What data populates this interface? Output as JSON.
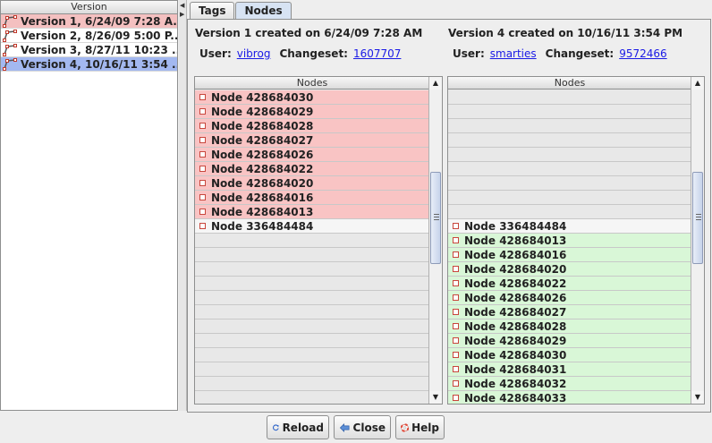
{
  "versions_panel": {
    "header": "Version",
    "items": [
      {
        "label": "Version 1, 6/24/09 7:28 A...",
        "style": "red"
      },
      {
        "label": "Version 2, 8/26/09 5:00 P...",
        "style": "white"
      },
      {
        "label": "Version 3, 8/27/11 10:23 ...",
        "style": "white"
      },
      {
        "label": "Version 4, 10/16/11 3:54 ...",
        "style": "blue"
      }
    ]
  },
  "tabs": [
    {
      "label": "Tags",
      "active": false
    },
    {
      "label": "Nodes",
      "active": true
    }
  ],
  "left_version": {
    "title": "Version 1 created on 6/24/09 7:28 AM",
    "user_label": "User:",
    "user": "vibrog",
    "changeset_label": "Changeset:",
    "changeset": "1607707"
  },
  "right_version": {
    "title": "Version 4 created on 10/16/11 3:54 PM",
    "user_label": "User:",
    "user": "smarties",
    "changeset_label": "Changeset:",
    "changeset": "9572466"
  },
  "left_table": {
    "header": "Nodes",
    "rows": [
      {
        "label": "Node 428684030",
        "style": "red"
      },
      {
        "label": "Node 428684029",
        "style": "red"
      },
      {
        "label": "Node 428684028",
        "style": "red"
      },
      {
        "label": "Node 428684027",
        "style": "red"
      },
      {
        "label": "Node 428684026",
        "style": "red"
      },
      {
        "label": "Node 428684022",
        "style": "red"
      },
      {
        "label": "Node 428684020",
        "style": "red"
      },
      {
        "label": "Node 428684016",
        "style": "red"
      },
      {
        "label": "Node 428684013",
        "style": "red"
      },
      {
        "label": "Node 336484484",
        "style": "plain"
      },
      {
        "label": "",
        "style": "empty"
      },
      {
        "label": "",
        "style": "empty"
      },
      {
        "label": "",
        "style": "empty"
      },
      {
        "label": "",
        "style": "empty"
      },
      {
        "label": "",
        "style": "empty"
      },
      {
        "label": "",
        "style": "empty"
      },
      {
        "label": "",
        "style": "empty"
      },
      {
        "label": "",
        "style": "empty"
      },
      {
        "label": "",
        "style": "empty"
      },
      {
        "label": "",
        "style": "empty"
      },
      {
        "label": "",
        "style": "empty"
      },
      {
        "label": "",
        "style": "empty"
      }
    ]
  },
  "right_table": {
    "header": "Nodes",
    "rows": [
      {
        "label": "",
        "style": "empty"
      },
      {
        "label": "",
        "style": "empty"
      },
      {
        "label": "",
        "style": "empty"
      },
      {
        "label": "",
        "style": "empty"
      },
      {
        "label": "",
        "style": "empty"
      },
      {
        "label": "",
        "style": "empty"
      },
      {
        "label": "",
        "style": "empty"
      },
      {
        "label": "",
        "style": "empty"
      },
      {
        "label": "",
        "style": "empty"
      },
      {
        "label": "Node 336484484",
        "style": "plain"
      },
      {
        "label": "Node 428684013",
        "style": "green"
      },
      {
        "label": "Node 428684016",
        "style": "green"
      },
      {
        "label": "Node 428684020",
        "style": "green"
      },
      {
        "label": "Node 428684022",
        "style": "green"
      },
      {
        "label": "Node 428684026",
        "style": "green"
      },
      {
        "label": "Node 428684027",
        "style": "green"
      },
      {
        "label": "Node 428684028",
        "style": "green"
      },
      {
        "label": "Node 428684029",
        "style": "green"
      },
      {
        "label": "Node 428684030",
        "style": "green"
      },
      {
        "label": "Node 428684031",
        "style": "green"
      },
      {
        "label": "Node 428684032",
        "style": "green"
      },
      {
        "label": "Node 428684033",
        "style": "green"
      }
    ]
  },
  "buttons": {
    "reload": "Reload",
    "close": "Close",
    "help": "Help"
  },
  "colors": {
    "removed": "#f9c4c4",
    "added": "#d9f7d7",
    "selected": "#a3b8f0",
    "link": "#1a1ae6"
  }
}
